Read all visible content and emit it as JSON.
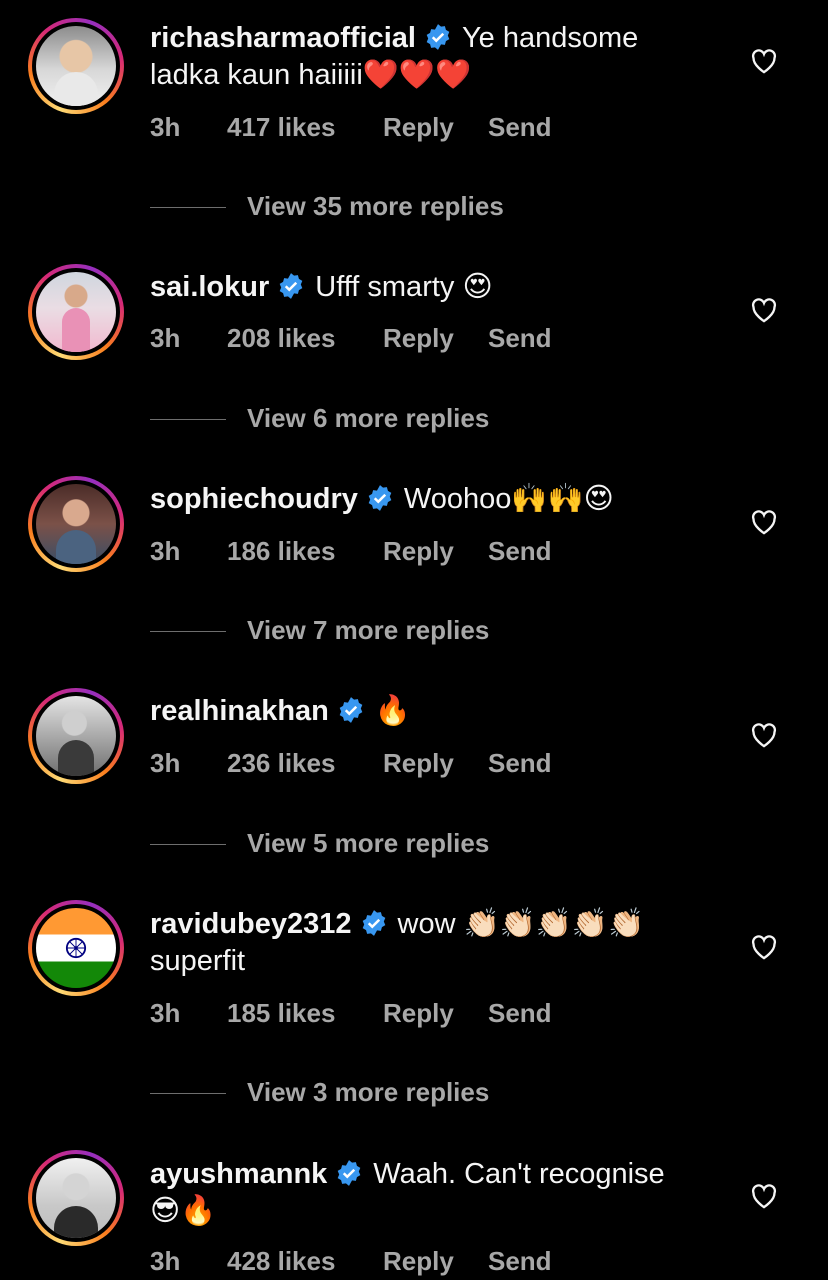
{
  "comments": [
    {
      "username": "richasharmaofficial",
      "text": "Ye handsome ladka kaun haiiiii❤️❤️❤️",
      "time": "3h",
      "likes": "417 likes",
      "reply": "Reply",
      "send": "Send",
      "view_replies": "View 35 more replies",
      "avatar": "portrait"
    },
    {
      "username": "sai.lokur",
      "text": "Ufff smarty 😍",
      "time": "3h",
      "likes": "208 likes",
      "reply": "Reply",
      "send": "Send",
      "view_replies": "View 6 more replies",
      "avatar": "pink-saree-portrait"
    },
    {
      "username": "sophiechoudry",
      "text": "Woohoo🙌🙌😍",
      "time": "3h",
      "likes": "186 likes",
      "reply": "Reply",
      "send": "Send",
      "view_replies": "View 7 more replies",
      "avatar": "portrait"
    },
    {
      "username": "realhinakhan",
      "text": "🔥",
      "time": "3h",
      "likes": "236 likes",
      "reply": "Reply",
      "send": "Send",
      "view_replies": "View 5 more replies",
      "avatar": "black-white-portrait"
    },
    {
      "username": "ravidubey2312",
      "text": "wow 👏🏻👏🏻👏🏻👏🏻👏🏻 superfit",
      "time": "3h",
      "likes": "185 likes",
      "reply": "Reply",
      "send": "Send",
      "view_replies": "View 3 more replies",
      "avatar": "india-flag"
    },
    {
      "username": "ayushmannk",
      "text": "Waah. Can't recognise 😎🔥",
      "time": "3h",
      "likes": "428 likes",
      "reply": "Reply",
      "send": "Send",
      "avatar": "black-white-portrait"
    }
  ],
  "colors": {
    "background": "#000000",
    "text": "#f5f5f5",
    "muted": "#a8a8a8",
    "verified": "#3897f0"
  },
  "icons": {
    "verified": "verified-badge-icon",
    "like": "heart-icon"
  }
}
